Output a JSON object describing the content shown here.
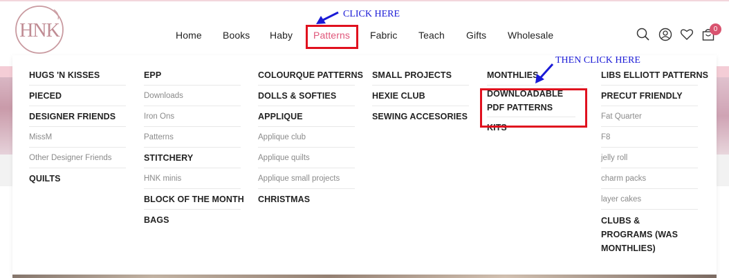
{
  "brand": {
    "logo_text": "HNK"
  },
  "nav": {
    "items": [
      "Home",
      "Books",
      "Haby",
      "Patterns",
      "Fabric",
      "Teach",
      "Gifts",
      "Wholesale"
    ],
    "active": "Patterns"
  },
  "header_icons": [
    "search-icon",
    "user-icon",
    "heart-icon",
    "cart-icon"
  ],
  "cart": {
    "count": "0"
  },
  "annotations": {
    "click_here": "CLICK HERE",
    "then_click_here": "THEN CLICK HERE"
  },
  "colors": {
    "accent": "#e0567a",
    "annotation_box": "#e0101e",
    "annotation_text": "#1a1ad6",
    "badge": "#d9536f"
  },
  "mega_menu": {
    "col1": [
      {
        "label": "HUGS 'N KISSES",
        "type": "head"
      },
      {
        "label": "PIECED",
        "type": "head"
      },
      {
        "label": "DESIGNER FRIENDS",
        "type": "head"
      },
      {
        "label": "MissM",
        "type": "sub"
      },
      {
        "label": "Other Designer Friends",
        "type": "sub"
      },
      {
        "label": "QUILTS",
        "type": "head"
      }
    ],
    "col2": [
      {
        "label": "EPP",
        "type": "head"
      },
      {
        "label": "Downloads",
        "type": "sub"
      },
      {
        "label": "Iron Ons",
        "type": "sub"
      },
      {
        "label": "Patterns",
        "type": "sub"
      },
      {
        "label": "STITCHERY",
        "type": "head"
      },
      {
        "label": "HNK minis",
        "type": "sub"
      },
      {
        "label": "BLOCK OF THE MONTH",
        "type": "head"
      },
      {
        "label": "BAGS",
        "type": "head"
      }
    ],
    "col3": [
      {
        "label": "COLOURQUE PATTERNS",
        "type": "head"
      },
      {
        "label": "DOLLS & SOFTIES",
        "type": "head"
      },
      {
        "label": "APPLIQUE",
        "type": "head"
      },
      {
        "label": "Applique club",
        "type": "sub"
      },
      {
        "label": "Applique quilts",
        "type": "sub"
      },
      {
        "label": "Applique small projects",
        "type": "sub"
      },
      {
        "label": "CHRISTMAS",
        "type": "head"
      }
    ],
    "col4": [
      {
        "label": "SMALL PROJECTS",
        "type": "head"
      },
      {
        "label": "HEXIE CLUB",
        "type": "head"
      },
      {
        "label": "SEWING ACCESORIES",
        "type": "head"
      }
    ],
    "col5": [
      {
        "label": "MONTHLIES",
        "type": "head"
      },
      {
        "label": "DOWNLOADABLE PDF PATTERNS",
        "type": "head"
      },
      {
        "label": "KITS",
        "type": "head"
      }
    ],
    "col6": [
      {
        "label": "LIBS ELLIOTT PATTERNS",
        "type": "head"
      },
      {
        "label": "PRECUT FRIENDLY",
        "type": "head"
      },
      {
        "label": "Fat Quarter",
        "type": "sub"
      },
      {
        "label": "F8",
        "type": "sub"
      },
      {
        "label": "jelly roll",
        "type": "sub"
      },
      {
        "label": "charm packs",
        "type": "sub"
      },
      {
        "label": "layer cakes",
        "type": "sub"
      },
      {
        "label": "CLUBS & PROGRAMS (WAS MONTHLIES)",
        "type": "head"
      }
    ]
  }
}
